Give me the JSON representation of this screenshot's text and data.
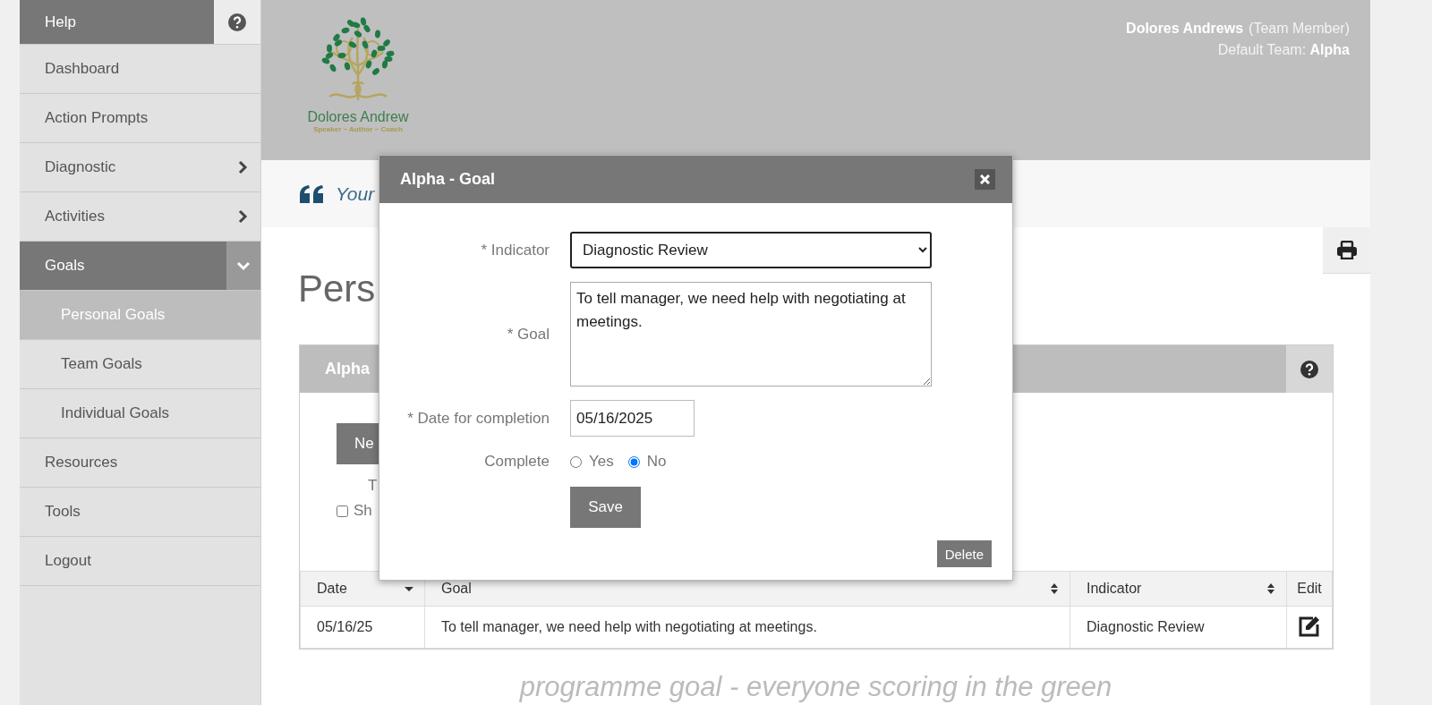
{
  "sidebar": {
    "help": {
      "label": "Help"
    },
    "items": [
      {
        "label": "Dashboard",
        "selected": false
      },
      {
        "label": "Action Prompts",
        "selected": false
      },
      {
        "label": "Diagnostic",
        "selected": false,
        "expanded": false
      },
      {
        "label": "Activities",
        "selected": false,
        "expanded": false
      },
      {
        "label": "Goals",
        "selected": false,
        "expanded": true,
        "children": [
          {
            "label": "Personal Goals",
            "selected": true
          },
          {
            "label": "Team Goals",
            "selected": false
          },
          {
            "label": "Individual Goals",
            "selected": false
          }
        ]
      },
      {
        "label": "Resources",
        "selected": false
      },
      {
        "label": "Tools",
        "selected": false
      },
      {
        "label": "Logout",
        "selected": false
      }
    ]
  },
  "header": {
    "logo": {
      "name": "Dolores Andrew",
      "tagline": "Speaker ~ Author ~ Coach"
    },
    "user": {
      "name": "Dolores Andrews",
      "role": "(Team Member)",
      "team_label": "Default Team:",
      "team": "Alpha"
    }
  },
  "quote": "Your",
  "page_title": "Pers",
  "panel": {
    "title": "Alpha",
    "new_button": "Ne",
    "note": "T",
    "checkbox": {
      "label": "Sh",
      "checked": false
    },
    "table": {
      "columns": [
        {
          "label": "Date",
          "sorted": true
        },
        {
          "label": "Goal",
          "sorted": false
        },
        {
          "label": "Indicator",
          "sorted": false
        },
        {
          "label": "Edit"
        }
      ],
      "rows": [
        {
          "cells": [
            "05/16/25",
            "To tell manager, we need help with negotiating at meetings.",
            "Diagnostic Review"
          ]
        }
      ]
    }
  },
  "footer": "programme goal - everyone scoring in the green",
  "modal": {
    "title": "Alpha - Goal",
    "indicator": {
      "label": "* Indicator",
      "value": "Diagnostic Review"
    },
    "goal": {
      "label": "* Goal",
      "value": "To tell manager, we need help with negotiating at meetings."
    },
    "date": {
      "label": "* Date for completion",
      "value": "05/16/2025"
    },
    "complete": {
      "label": "Complete",
      "options": [
        {
          "label": "Yes",
          "selected": false
        },
        {
          "label": "No",
          "selected": true
        }
      ]
    },
    "save": "Save",
    "delete": "Delete"
  }
}
